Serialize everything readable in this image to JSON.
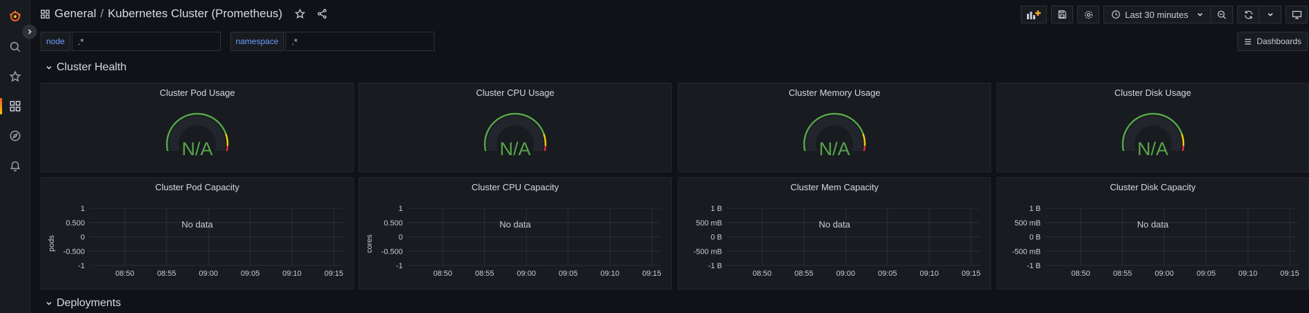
{
  "breadcrumb": {
    "folder": "General",
    "separator": "/",
    "dashboard": "Kubernetes Cluster (Prometheus)"
  },
  "toolbar": {
    "time_range": "Last 30 minutes",
    "dashboards_label": "Dashboards"
  },
  "variables": [
    {
      "label": "node",
      "value": ".*"
    },
    {
      "label": "namespace",
      "value": ".*"
    }
  ],
  "rows": [
    {
      "title": "Cluster Health"
    },
    {
      "title": "Deployments"
    }
  ],
  "gauges": [
    {
      "title": "Cluster Pod Usage",
      "value": "N/A"
    },
    {
      "title": "Cluster CPU Usage",
      "value": "N/A"
    },
    {
      "title": "Cluster Memory Usage",
      "value": "N/A"
    },
    {
      "title": "Cluster Disk Usage",
      "value": "N/A"
    }
  ],
  "graphs": [
    {
      "title": "Cluster Pod Capacity",
      "ylabel": "pods",
      "yticks": [
        "1",
        "0.500",
        "0",
        "-0.500",
        "-1"
      ],
      "xticks": [
        "08:50",
        "08:55",
        "09:00",
        "09:05",
        "09:10",
        "09:15"
      ],
      "message": "No data"
    },
    {
      "title": "Cluster CPU Capacity",
      "ylabel": "cores",
      "yticks": [
        "1",
        "0.500",
        "0",
        "-0.500",
        "-1"
      ],
      "xticks": [
        "08:50",
        "08:55",
        "09:00",
        "09:05",
        "09:10",
        "09:15"
      ],
      "message": "No data"
    },
    {
      "title": "Cluster Mem Capacity",
      "ylabel": "",
      "yticks": [
        "1 B",
        "500 mB",
        "0 B",
        "-500 mB",
        "-1 B"
      ],
      "xticks": [
        "08:50",
        "08:55",
        "09:00",
        "09:05",
        "09:10",
        "09:15"
      ],
      "message": "No data"
    },
    {
      "title": "Cluster Disk Capacity",
      "ylabel": "",
      "yticks": [
        "1 B",
        "500 mB",
        "0 B",
        "-500 mB",
        "-1 B"
      ],
      "xticks": [
        "08:50",
        "08:55",
        "09:00",
        "09:05",
        "09:10",
        "09:15"
      ],
      "message": "No data"
    }
  ],
  "colors": {
    "gauge_ok": "#56a64b",
    "gauge_warn": "#f2cc0c",
    "gauge_crit": "#e02f44",
    "accent": "#f05a28"
  },
  "icons": [
    "grafana-logo-icon",
    "search-icon",
    "star-icon",
    "dashboards-icon",
    "explore-icon",
    "alert-bell-icon",
    "chevron-right-icon",
    "grid-icon",
    "star-outline-icon",
    "share-icon",
    "add-panel-icon",
    "save-icon",
    "gear-icon",
    "clock-icon",
    "chevron-down-icon",
    "zoom-out-icon",
    "refresh-icon",
    "tv-icon",
    "list-icon"
  ]
}
